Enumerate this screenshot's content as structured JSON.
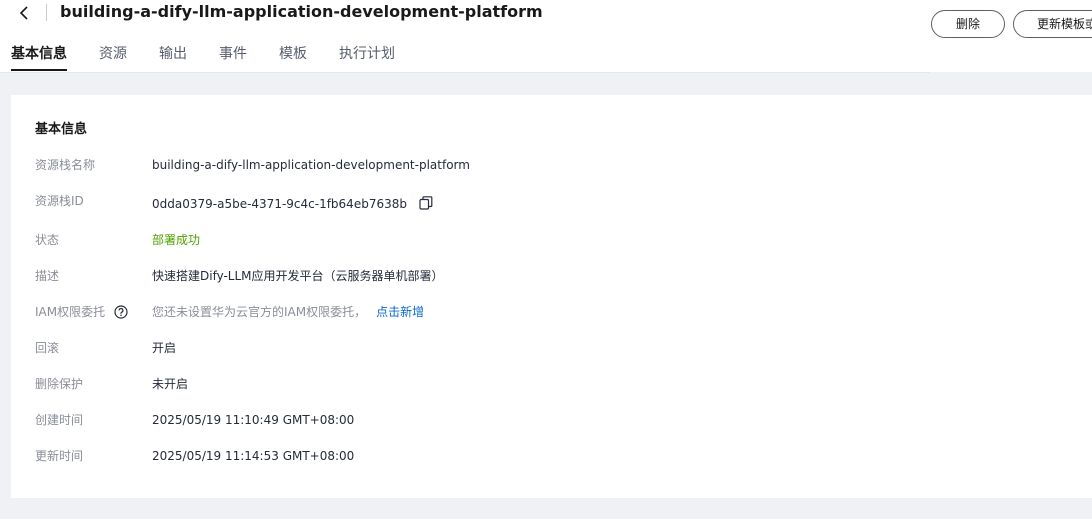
{
  "header": {
    "title": "building-a-dify-llm-application-development-platform",
    "delete_label": "删除",
    "update_template_label": "更新模板或参数"
  },
  "tabs": [
    {
      "label": "基本信息",
      "active": true
    },
    {
      "label": "资源"
    },
    {
      "label": "输出"
    },
    {
      "label": "事件"
    },
    {
      "label": "模板"
    },
    {
      "label": "执行计划"
    }
  ],
  "basic_info": {
    "section_title": "基本信息",
    "stack_name": {
      "label": "资源栈名称",
      "value": "building-a-dify-llm-application-development-platform"
    },
    "stack_id": {
      "label": "资源栈ID",
      "value": "0dda0379-a5be-4371-9c4c-1fb64eb7638b"
    },
    "status": {
      "label": "状态",
      "value": "部署成功"
    },
    "description": {
      "label": "描述",
      "value": "快速搭建Dify-LLM应用开发平台（云服务器单机部署）"
    },
    "iam_agency": {
      "label": "IAM权限委托",
      "value": "您还未设置华为云官方的IAM权限委托，",
      "link": "点击新增"
    },
    "rollback": {
      "label": "回滚",
      "value": "开启"
    },
    "delete_protection": {
      "label": "删除保护",
      "value": "未开启"
    },
    "created_at": {
      "label": "创建时间",
      "value": "2025/05/19 11:10:49 GMT+08:00"
    },
    "updated_at": {
      "label": "更新时间",
      "value": "2025/05/19 11:14:53 GMT+08:00"
    }
  },
  "colors": {
    "success": "#50a000",
    "link": "#0b6acf",
    "page_background": "#f0f1f5"
  }
}
